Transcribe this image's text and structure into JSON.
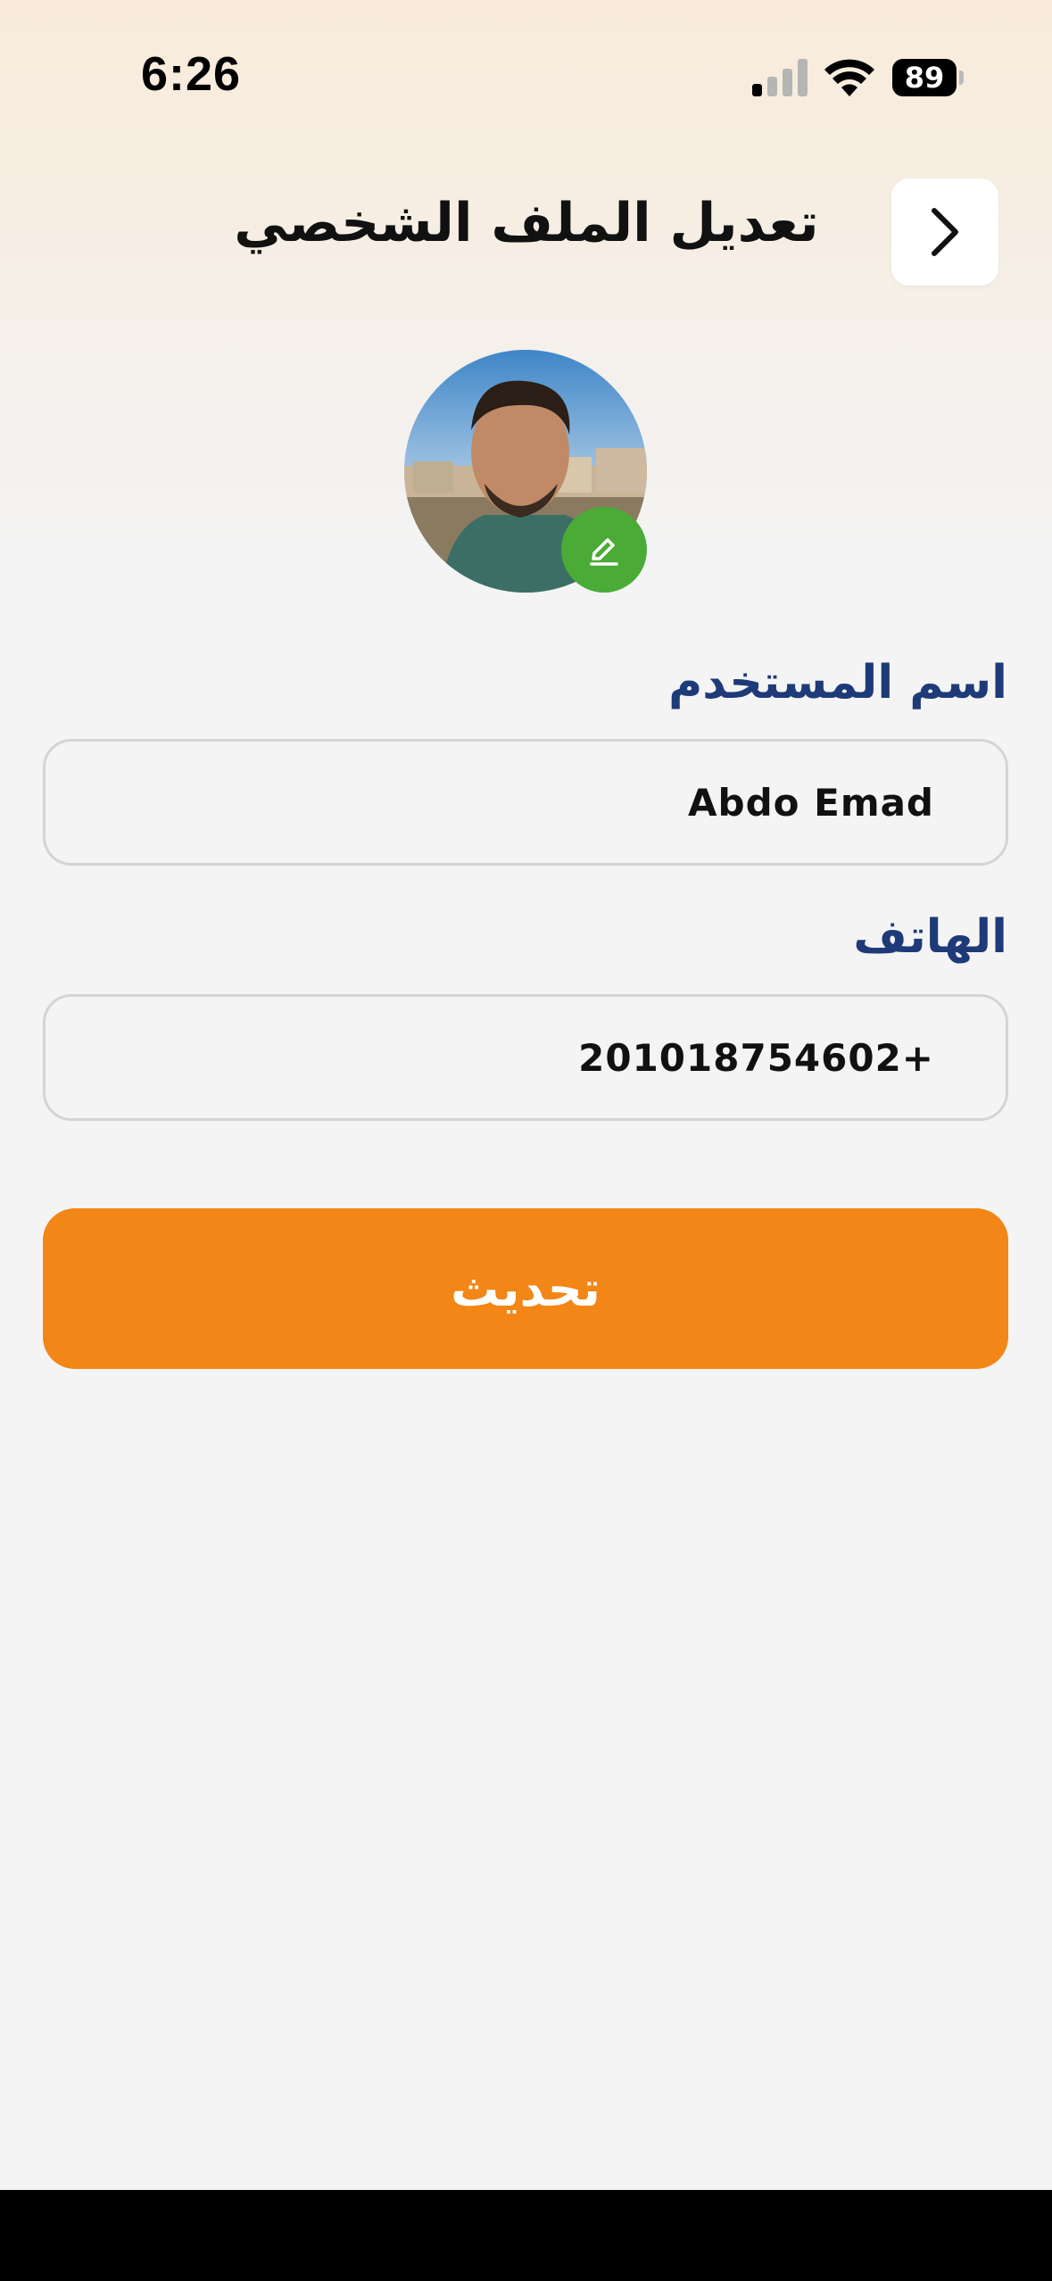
{
  "status_bar": {
    "time": "6:26",
    "battery": "89",
    "icons": [
      "cellular-signal-icon",
      "wifi-icon",
      "battery-icon"
    ]
  },
  "header": {
    "title": "تعديل الملف الشخصي",
    "back_icon": "chevron-right-icon"
  },
  "profile": {
    "avatar": "profile-photo",
    "edit_icon": "pencil-icon"
  },
  "form": {
    "username_label": "اسم المستخدم",
    "username_value": "Abdo Emad",
    "phone_label": "الهاتف",
    "phone_value": "201018754602+",
    "submit_label": "تحديث"
  },
  "colors": {
    "accent": "#f28616",
    "label": "#1e3a78",
    "edit_badge": "#4aab37",
    "field_border": "#d4d4d4"
  }
}
